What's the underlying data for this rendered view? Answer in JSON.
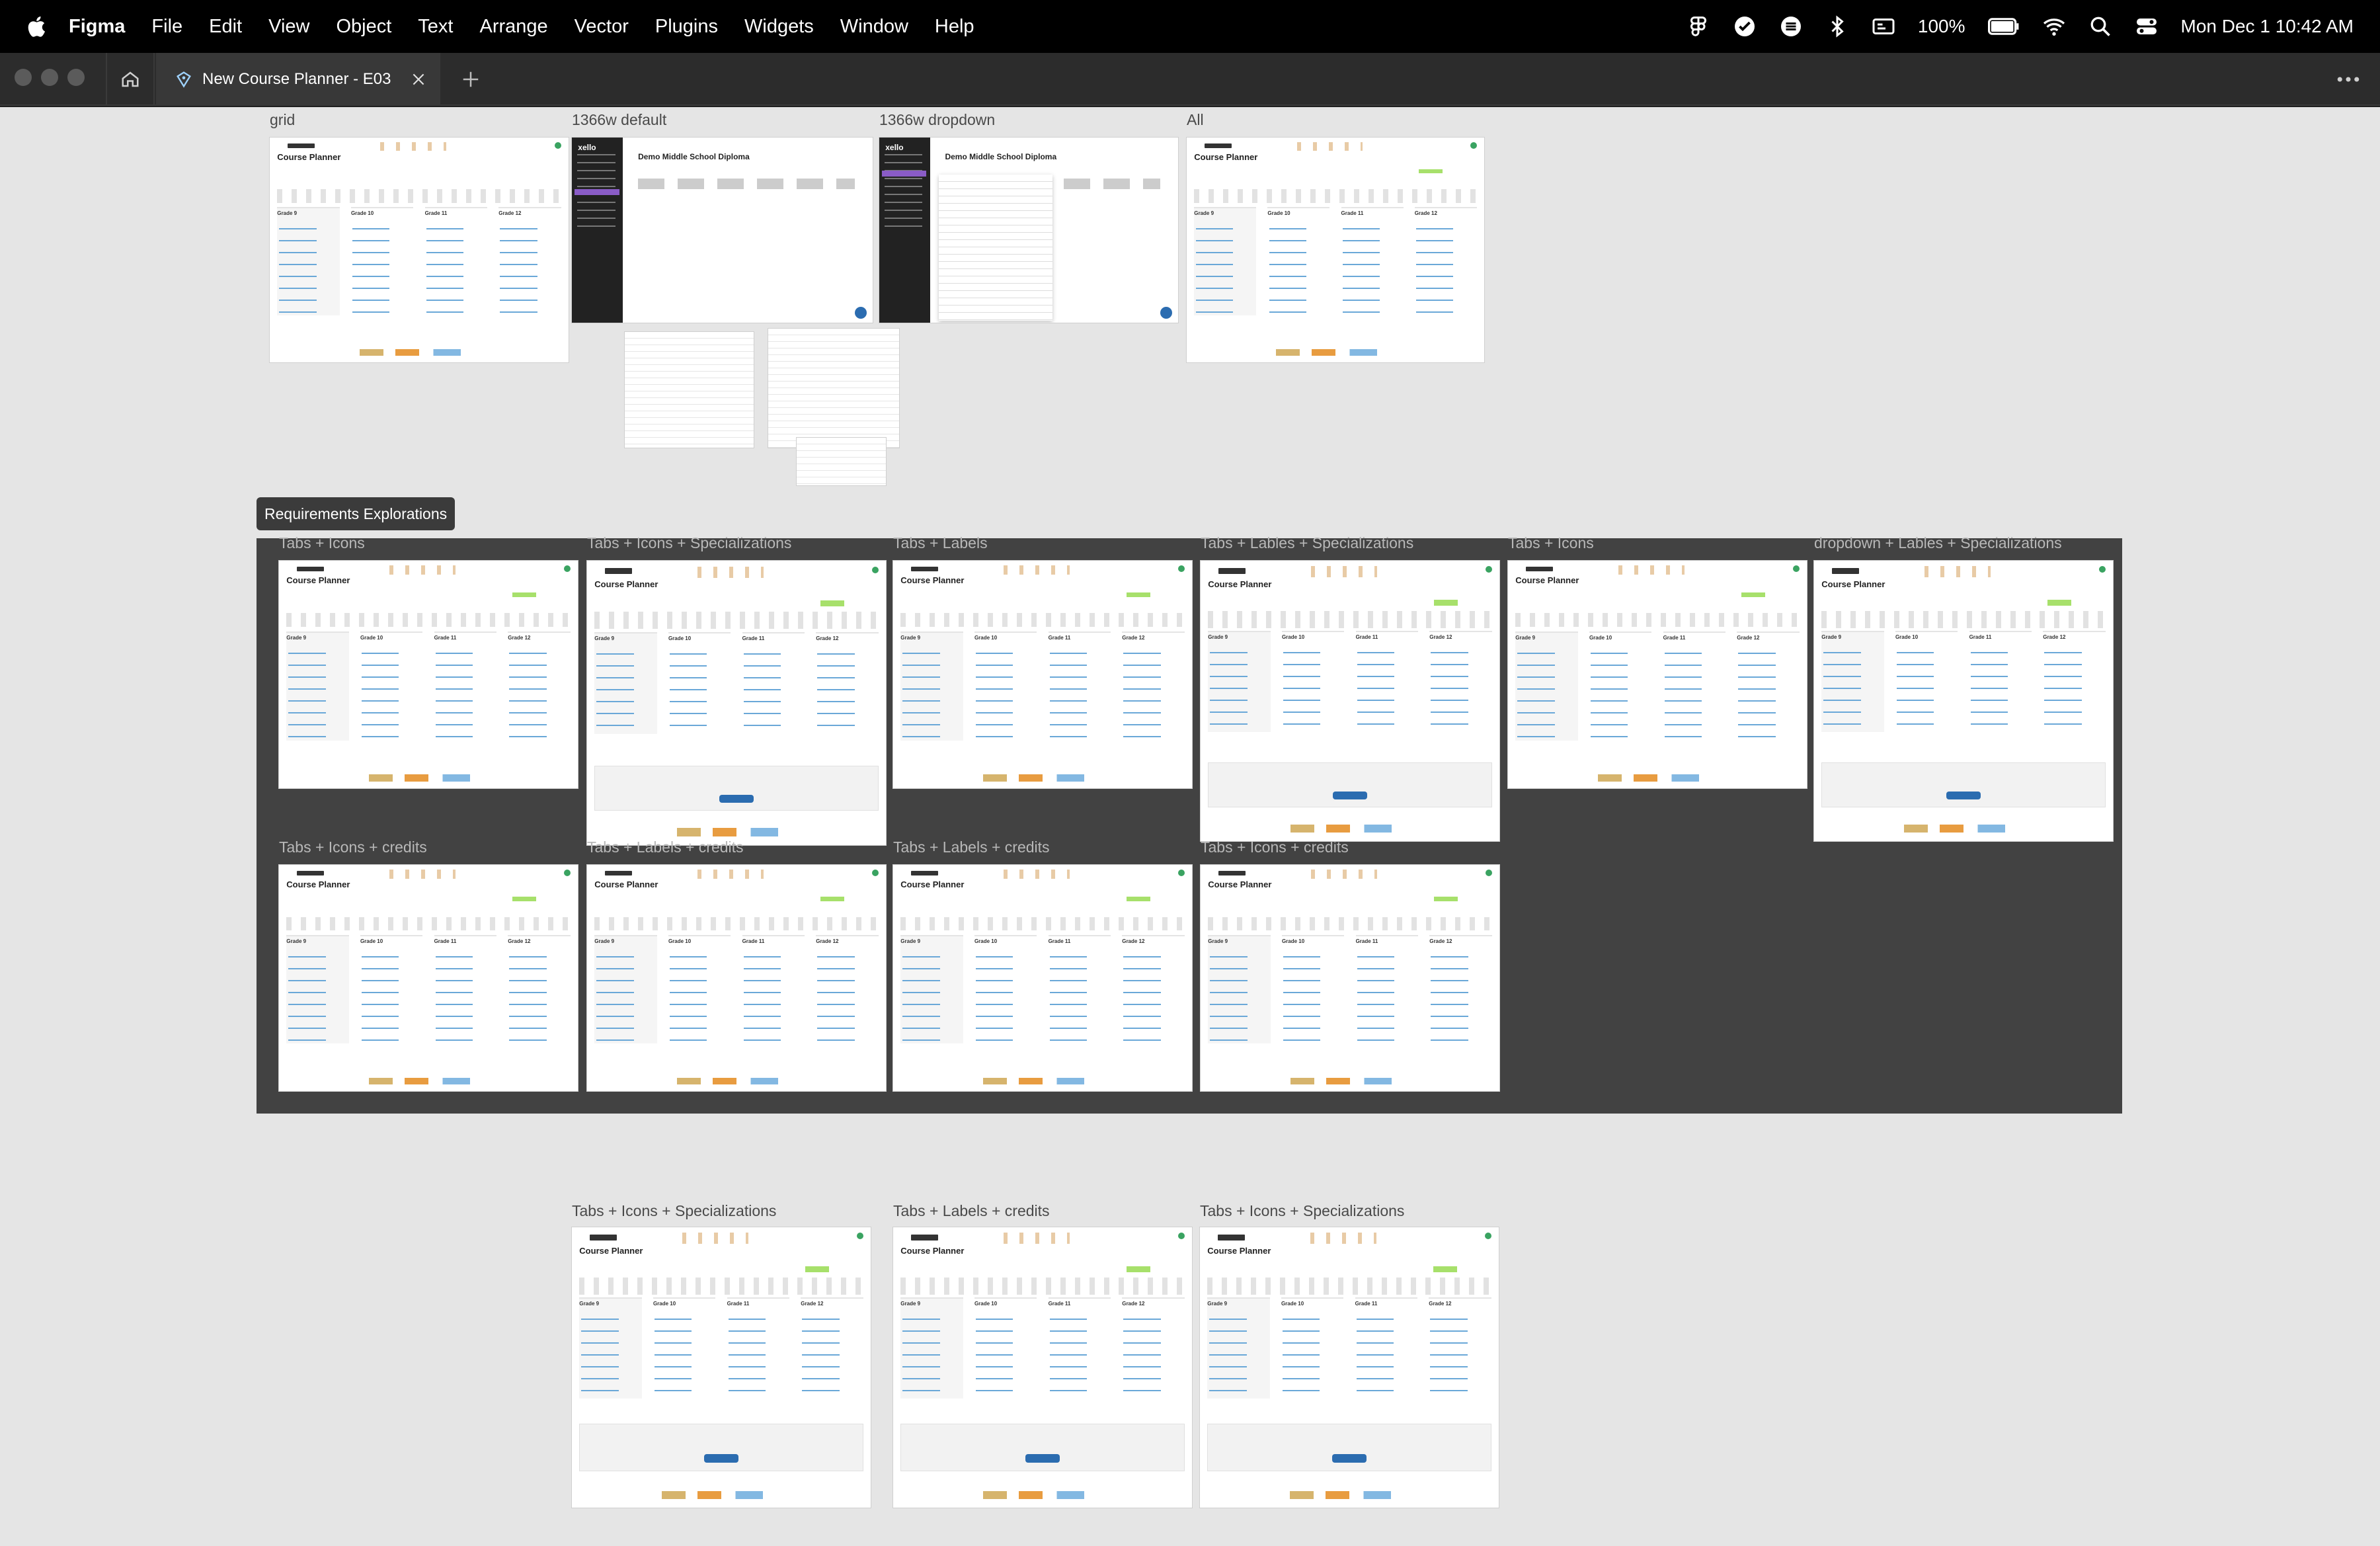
{
  "menubar": {
    "app": "Figma",
    "items": [
      "File",
      "Edit",
      "View",
      "Object",
      "Text",
      "Arrange",
      "Vector",
      "Plugins",
      "Widgets",
      "Window",
      "Help"
    ],
    "battery": "100%",
    "datetime": "Mon Dec 1  10:42 AM"
  },
  "tabs": {
    "active_file": "New Course Planner - E03"
  },
  "canvas": {
    "top_frames": [
      {
        "label": "grid",
        "title": "Course Planner"
      },
      {
        "label": "1366w default",
        "title": "Demo Middle School Diploma"
      },
      {
        "label": "1366w dropdown",
        "title": "Demo Middle School Diploma"
      },
      {
        "label": "All",
        "title": "Course Planner"
      }
    ],
    "section_label": "Requirements Explorations",
    "section_row1": [
      "Tabs + Icons",
      "Tabs + Icons + Specializations",
      "Tabs + Labels",
      "Tabs + Lables + Specializations",
      "Tabs + Icons",
      "dropdown + Lables + Specializations"
    ],
    "section_row2": [
      "Tabs + Icons + credits",
      "Tabs + Labels + credits",
      "Tabs + Labels + credits",
      "Tabs + Icons + credits"
    ],
    "bottom_row": [
      "Tabs + Icons + Specializations",
      "Tabs + Labels + credits",
      "Tabs + Icons + Specializations"
    ],
    "frame_title": "Course Planner",
    "grades": [
      "Grade 9",
      "Grade 10",
      "Grade 11",
      "Grade 12"
    ],
    "logo_text": "xello"
  }
}
